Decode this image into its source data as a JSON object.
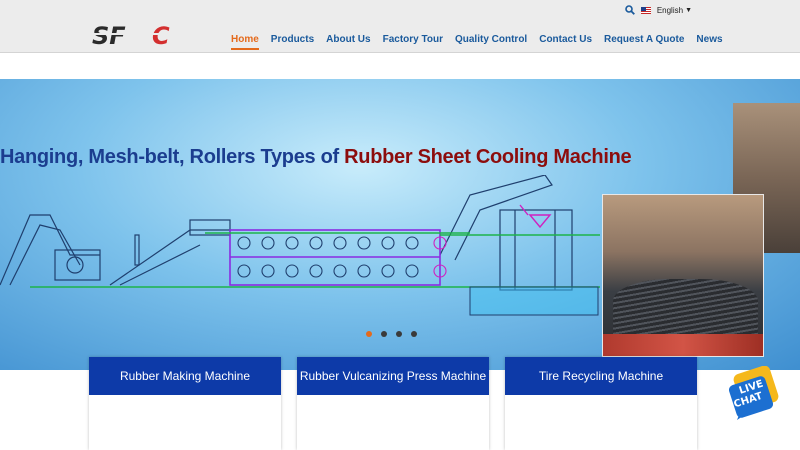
{
  "header": {
    "logo_text": "SFC",
    "language": "English",
    "nav": [
      {
        "label": "Home",
        "active": true
      },
      {
        "label": "Products"
      },
      {
        "label": "About Us"
      },
      {
        "label": "Factory Tour"
      },
      {
        "label": "Quality Control"
      },
      {
        "label": "Contact Us"
      },
      {
        "label": "Request A Quote"
      },
      {
        "label": "News"
      }
    ]
  },
  "hero": {
    "title_part1": "Hanging, Mesh-belt, Rollers Types of ",
    "title_part2": "Rubber Sheet Cooling Machine",
    "slide_active": 1,
    "slide_count": 4
  },
  "cards": [
    {
      "label": "Rubber Making Machine"
    },
    {
      "label": "Rubber Vulcanizing Press Machine"
    },
    {
      "label": "Tire Recycling Machine"
    }
  ],
  "chat": {
    "line1": "LIVE",
    "line2": "CHAT"
  },
  "colors": {
    "accent": "#e46a1c",
    "nav_text": "#1a5a9c",
    "card_header": "#0d3aa8",
    "title_blue": "#1b3d8f",
    "title_red": "#8c0d0d"
  }
}
